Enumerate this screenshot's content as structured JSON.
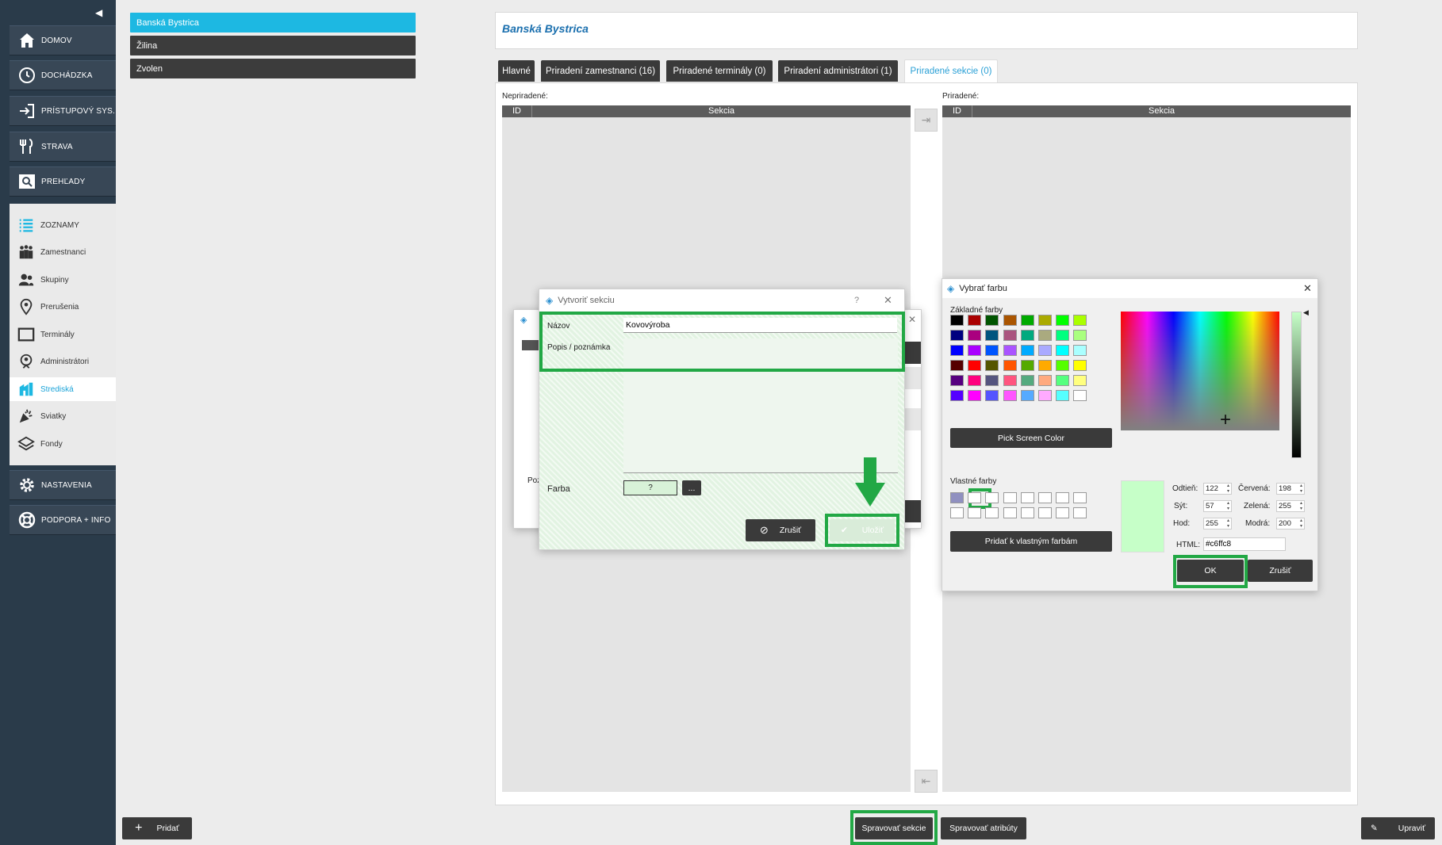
{
  "sidebar": {
    "collapse_icon": "◀",
    "top_items": [
      {
        "label": "DOMOV",
        "icon": "home-icon"
      },
      {
        "label": "DOCHÁDZKA",
        "icon": "clock-icon"
      },
      {
        "label": "PRÍSTUPOVÝ SYS.",
        "icon": "login-icon"
      },
      {
        "label": "STRAVA",
        "icon": "cutlery-icon"
      },
      {
        "label": "PREHĽADY",
        "icon": "magnifier-icon"
      }
    ],
    "submenu": [
      {
        "label": "ZOZNAMY",
        "icon": "list-icon"
      },
      {
        "label": "Zamestnanci",
        "icon": "people-icon"
      },
      {
        "label": "Skupiny",
        "icon": "group-icon"
      },
      {
        "label": "Prerušenia",
        "icon": "location-pin-icon"
      },
      {
        "label": "Terminály",
        "icon": "terminal-icon"
      },
      {
        "label": "Administrátori",
        "icon": "admin-icon"
      },
      {
        "label": "Strediská",
        "icon": "building-icon"
      },
      {
        "label": "Sviatky",
        "icon": "party-icon"
      },
      {
        "label": "Fondy",
        "icon": "layers-icon"
      }
    ],
    "bottom_items": [
      {
        "label": "NASTAVENIA",
        "icon": "gear-icon"
      },
      {
        "label": "PODPORA + INFO",
        "icon": "lifebuoy-icon"
      }
    ]
  },
  "branches": [
    "Banská Bystrica",
    "Žilina",
    "Zvolen"
  ],
  "main": {
    "title": "Banská Bystrica",
    "tabs": [
      "Hlavné",
      "Priradení zamestnanci (16)",
      "Priradené terminály (0)",
      "Priradení administrátori (1)",
      "Priradené sekcie (0)"
    ],
    "left_label": "Nepriradené:",
    "right_label": "Priradené:",
    "col_id": "ID",
    "col_section": "Sekcia",
    "move_right_icon": "⇥",
    "move_left_icon": "⇤"
  },
  "bottom": {
    "add_label": "Pridať",
    "manage_sections_label": "Spravovať sekcie",
    "manage_attributes_label": "Spravovať atribúty",
    "edit_label": "Upraviť"
  },
  "create_dialog": {
    "title": "Vytvoriť sekciu",
    "help": "?",
    "close": "✕",
    "name_label": "Názov",
    "name_value": "Kovovýroba",
    "note_label": "Popis / poznámka",
    "color_label": "Farba",
    "color_value": "?",
    "color_picker_button": "...",
    "cancel_label": "Zrušiť",
    "save_label": "Uložiť"
  },
  "bg_dialog": {
    "partial_label": "Poz"
  },
  "color_dialog": {
    "title": "Vybrať farbu",
    "close": "✕",
    "basic_label": "Základné farby",
    "pick_screen": "Pick Screen Color",
    "custom_label": "Vlastné farby",
    "add_custom": "Pridať k vlastným farbám",
    "hue_label": "Odtieň:",
    "hue": "122",
    "sat_label": "Sýt:",
    "sat": "57",
    "val_label": "Hod:",
    "val": "255",
    "red_label": "Červená:",
    "red": "198",
    "green_label": "Zelená:",
    "green": "255",
    "blue_label": "Modrá:",
    "blue": "200",
    "html_label": "HTML:",
    "html": "#c6ffc8",
    "ok_label": "OK",
    "cancel_label": "Zrušiť",
    "current_color": "#c6ffc8",
    "basic_colors": [
      "#000000",
      "#aa0000",
      "#005500",
      "#aa5500",
      "#00aa00",
      "#aaaa00",
      "#00ff00",
      "#aaff00",
      "#00007f",
      "#aa007f",
      "#00557f",
      "#aa557f",
      "#00aa7f",
      "#aaaa7f",
      "#00ff7f",
      "#aaff7f",
      "#0000ff",
      "#aa00ff",
      "#0055ff",
      "#aa55ff",
      "#00aaff",
      "#aaaaff",
      "#00ffff",
      "#aaffff",
      "#550000",
      "#ff0000",
      "#555500",
      "#ff5500",
      "#55aa00",
      "#ffaa00",
      "#55ff00",
      "#ffff00",
      "#55007f",
      "#ff007f",
      "#55557f",
      "#ff557f",
      "#55aa7f",
      "#ffaa7f",
      "#55ff7f",
      "#ffff7f",
      "#5500ff",
      "#ff00ff",
      "#5555ff",
      "#ff55ff",
      "#55aaff",
      "#ffaaff",
      "#55ffff",
      "#ffffff"
    ],
    "custom_colors": [
      "#9090c0",
      "#ffffff",
      "#ffffff",
      "#ffffff",
      "#ffffff",
      "#ffffff",
      "#ffffff",
      "#ffffff",
      "#ffffff",
      "#ffffff",
      "#ffffff",
      "#ffffff",
      "#ffffff",
      "#ffffff",
      "#ffffff",
      "#ffffff"
    ]
  },
  "colors": {
    "accent": "#1db8e2",
    "highlight_green": "#22a845",
    "sidebar_bg": "#2a3b4a"
  }
}
